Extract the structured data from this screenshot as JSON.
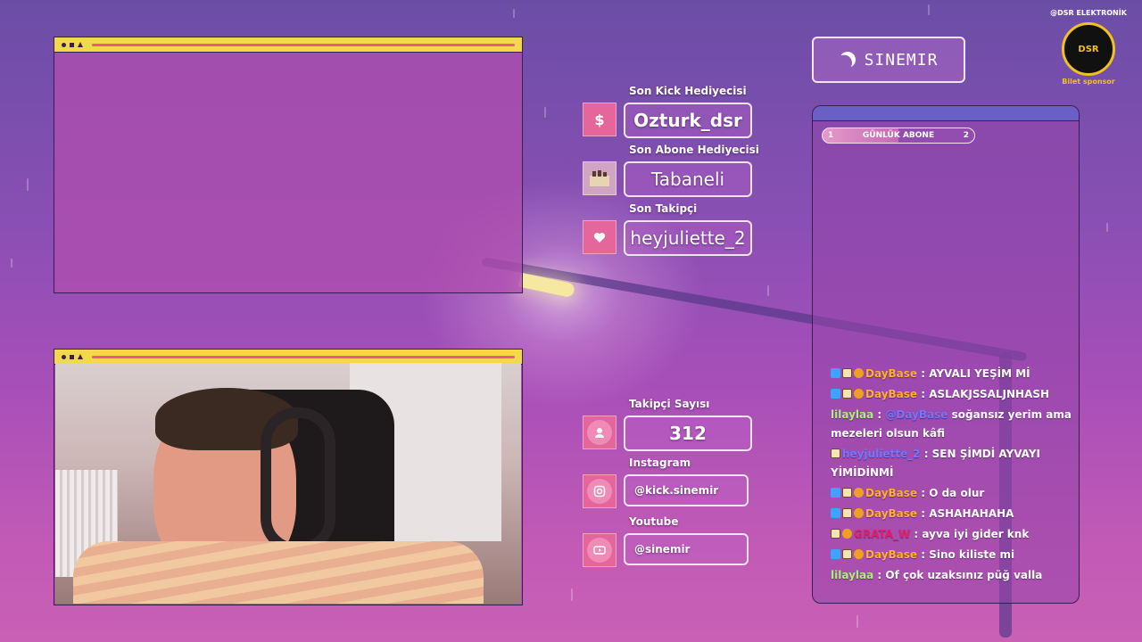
{
  "header": {
    "streamer_name": "SINEMIR",
    "sponsor": {
      "handle": "@DSR ELEKTRONİK",
      "logo_text": "DSR",
      "tagline": "Bilet sponsor"
    }
  },
  "stats": {
    "kick_gifter": {
      "label": "Son Kick Hediyecisi",
      "value": "Ozturk_dsr",
      "icon": "dollar-icon"
    },
    "sub_gifter": {
      "label": "Son Abone Hediyecisi",
      "value": "Tabaneli",
      "icon": "gift-box-icon"
    },
    "last_follower": {
      "label": "Son Takipçi",
      "value": "heyjuliette_2",
      "icon": "heart-icon"
    },
    "follower_count": {
      "label": "Takipçi Sayısı",
      "value": "312",
      "icon": "person-icon"
    },
    "instagram": {
      "label": "Instagram",
      "value": "@kick.sinemir",
      "icon": "instagram-icon"
    },
    "youtube": {
      "label": "Youtube",
      "value": "@sinemir",
      "icon": "youtube-icon"
    }
  },
  "chat": {
    "goal": {
      "label": "GÜNLÜK ABONE",
      "current": "1",
      "target": "2"
    },
    "messages": [
      {
        "user": "DayBase",
        "text": ": AYVALI YEŞİM Mİ",
        "color": "#ffb12b"
      },
      {
        "user": "DayBase",
        "text": ": ASLAKJSSALJNHASH",
        "color": "#ffb12b"
      },
      {
        "user": "lilaylaa",
        "mention": "@DayBase",
        "text": "soğansız yerim ama mezeleri olsun kâfi",
        "color": "#a8f07a"
      },
      {
        "user": "heyjuliette_2",
        "text": ": SEN ŞİMDİ AYVAYI YİMİDİNMİ",
        "color": "#6f78ff"
      },
      {
        "user": "DayBase",
        "text": ": O da olur",
        "color": "#ffb12b"
      },
      {
        "user": "DayBase",
        "text": ": ASHAHAHAHA",
        "color": "#ffb12b"
      },
      {
        "user": "GRATA_W",
        "text": ": ayva iyi gider knk",
        "color": "#e0206a"
      },
      {
        "user": "DayBase",
        "text": ": Sino kiliste mi",
        "color": "#ffb12b"
      },
      {
        "user": "lilaylaa",
        "text": ": Of çok uzaksınız püğ valla",
        "color": "#a8f07a"
      }
    ]
  },
  "colors": {
    "accent_pink": "#e5669a",
    "window_bar": "#f3d84a",
    "chat_bar": "#6a5fc4"
  }
}
